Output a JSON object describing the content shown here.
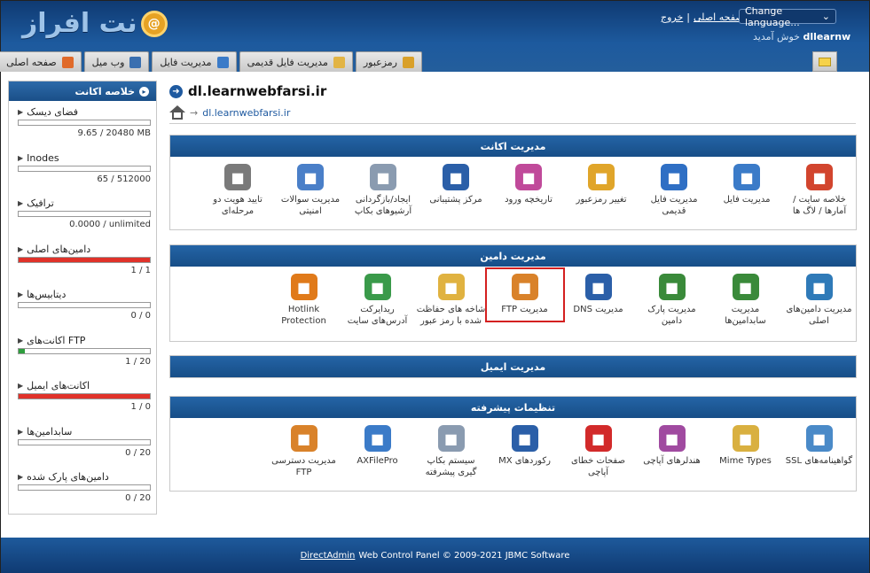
{
  "header": {
    "logo_text": "نت افراز",
    "logo_mark": "@",
    "links": {
      "logout": "خروج",
      "separator": "|",
      "home": "صفحه اصلی"
    },
    "language_select": "Change language...",
    "welcome_text": "خوش آمدید",
    "username": "dllearnw"
  },
  "nav": [
    {
      "label": "صفحه اصلی",
      "icon": "house-icon",
      "color": "#e06a2a"
    },
    {
      "label": "وب میل",
      "icon": "envelope-icon",
      "color": "#3a6fb0"
    },
    {
      "label": "مدیریت فایل",
      "icon": "file-manager-icon",
      "color": "#3b7bc8"
    },
    {
      "label": "مدیریت فایل قدیمی",
      "icon": "folder-icon",
      "color": "#e2b445"
    },
    {
      "label": "رمزعبور",
      "icon": "key-icon",
      "color": "#d9a02a"
    }
  ],
  "sidebar": {
    "title": "خلاصه اکانت",
    "items": [
      {
        "label": "فضای دیسک",
        "value": "9.65 / 20480 MB",
        "percent": 0.0,
        "fill": "#2e9e3d"
      },
      {
        "label": "Inodes",
        "value": "65 / 512000",
        "percent": 0.0,
        "fill": "#2e9e3d"
      },
      {
        "label": "ترافیک",
        "value": "0.0000 / unlimited",
        "percent": 0.0,
        "fill": "#2e9e3d"
      },
      {
        "label": "دامین‌های اصلی",
        "value": "1 / 1",
        "percent": 100,
        "fill": "#e0322a"
      },
      {
        "label": "دیتابیس‌ها",
        "value": "0 / 0",
        "percent": 0,
        "fill": "#2e9e3d"
      },
      {
        "label": "اکانت‌های FTP",
        "value": "1 / 20",
        "percent": 5,
        "fill": "#2e9e3d"
      },
      {
        "label": "اکانت‌های ایمیل",
        "value": "1 / 0",
        "percent": 100,
        "fill": "#e0322a"
      },
      {
        "label": "سابدامین‌ها",
        "value": "0 / 20",
        "percent": 0,
        "fill": "#2e9e3d"
      },
      {
        "label": "دامین‌های پارک شده",
        "value": "0 / 20",
        "percent": 0,
        "fill": "#2e9e3d"
      }
    ]
  },
  "main": {
    "title": "dl.learnwebfarsi.ir",
    "breadcrumb_arrow": "→",
    "breadcrumb": "dl.learnwebfarsi.ir"
  },
  "sections": {
    "account": {
      "title": "مدیریت اکانت",
      "items": [
        {
          "label": "خلاصه سایت / آمارها / لاگ ها",
          "icon": "site-summary-icon",
          "color": "#d2452e"
        },
        {
          "label": "مدیریت فایل",
          "icon": "file-manager-icon",
          "color": "#3b7bc8"
        },
        {
          "label": "مدیریت فایل قدیمی",
          "icon": "files-icon",
          "color": "#2f6fc4"
        },
        {
          "label": "تغییر رمزعبور",
          "icon": "lock-icon",
          "color": "#e0a52a"
        },
        {
          "label": "تاریخچه ورود",
          "icon": "login-history-icon",
          "color": "#c04a9a"
        },
        {
          "label": "مرکز پشتیبانی",
          "icon": "support-icon",
          "color": "#2b5fa8"
        },
        {
          "label": "ایجاد/بازگردانی آرشیوهای بکاپ",
          "icon": "backup-icon",
          "color": "#8a9bb0"
        },
        {
          "label": "مدیریت سوالات امنیتی",
          "icon": "security-shield-icon",
          "color": "#4a7fc8"
        },
        {
          "label": "تایید هویت دو مرحله‌ای",
          "icon": "two-step-auth-icon",
          "color": "#7a7a7a"
        }
      ]
    },
    "domain": {
      "title": "مدیریت دامین",
      "items": [
        {
          "label": "مدیریت دامین‌های اصلی",
          "icon": "globe-gear-icon",
          "color": "#2f7ab8"
        },
        {
          "label": "مدیریت سابدامین‌ها",
          "icon": "globe-icon",
          "color": "#3a8a3a"
        },
        {
          "label": "مدیریت پارک دامین",
          "icon": "globe-park-icon",
          "color": "#3a8a3a"
        },
        {
          "label": "مدیریت DNS",
          "icon": "dns-icon",
          "color": "#2b5fa8"
        },
        {
          "label": "مدیریت FTP",
          "icon": "ftp-folder-icon",
          "color": "#d9822a"
        },
        {
          "label": "شاخه های حفاظت شده با رمز عبور",
          "icon": "protected-folder-icon",
          "color": "#e0b240"
        },
        {
          "label": "ریدایرکت آدرس‌های سایت",
          "icon": "redirect-icon",
          "color": "#3a9a4a"
        },
        {
          "label": "Hotlink Protection",
          "icon": "hotlink-chain-icon",
          "color": "#e07a1a"
        }
      ]
    },
    "email": {
      "title": "مدیریت ایمیل"
    },
    "advanced": {
      "title": "تنظیمات پیشرفته",
      "items": [
        {
          "label": "گواهینامه‌های SSL",
          "icon": "ssl-certificate-icon",
          "color": "#4a8ac8"
        },
        {
          "label": "Mime Types",
          "icon": "mime-types-icon",
          "color": "#d9b040"
        },
        {
          "label": "هندلرهای آپاچی",
          "icon": "apache-handlers-icon",
          "color": "#a04aa0"
        },
        {
          "label": "صفحات خطای آپاچی",
          "icon": "apache-error-icon",
          "color": "#d22a2a"
        },
        {
          "label": "رکوردهای MX",
          "icon": "mx-records-icon",
          "color": "#2b5fa8"
        },
        {
          "label": "سیستم بکاپ گیری پیشرفته",
          "icon": "advanced-backup-icon",
          "color": "#8a9bb0"
        },
        {
          "label": "AXFilePro",
          "icon": "axfilepro-icon",
          "color": "#3b7bc8"
        },
        {
          "label": "مدیریت دسترسی FTP",
          "icon": "ftp-access-icon",
          "color": "#d9822a"
        }
      ]
    }
  },
  "footer": {
    "link": "DirectAdmin",
    "text": "Web Control Panel © 2009-2021 JBMC Software"
  }
}
